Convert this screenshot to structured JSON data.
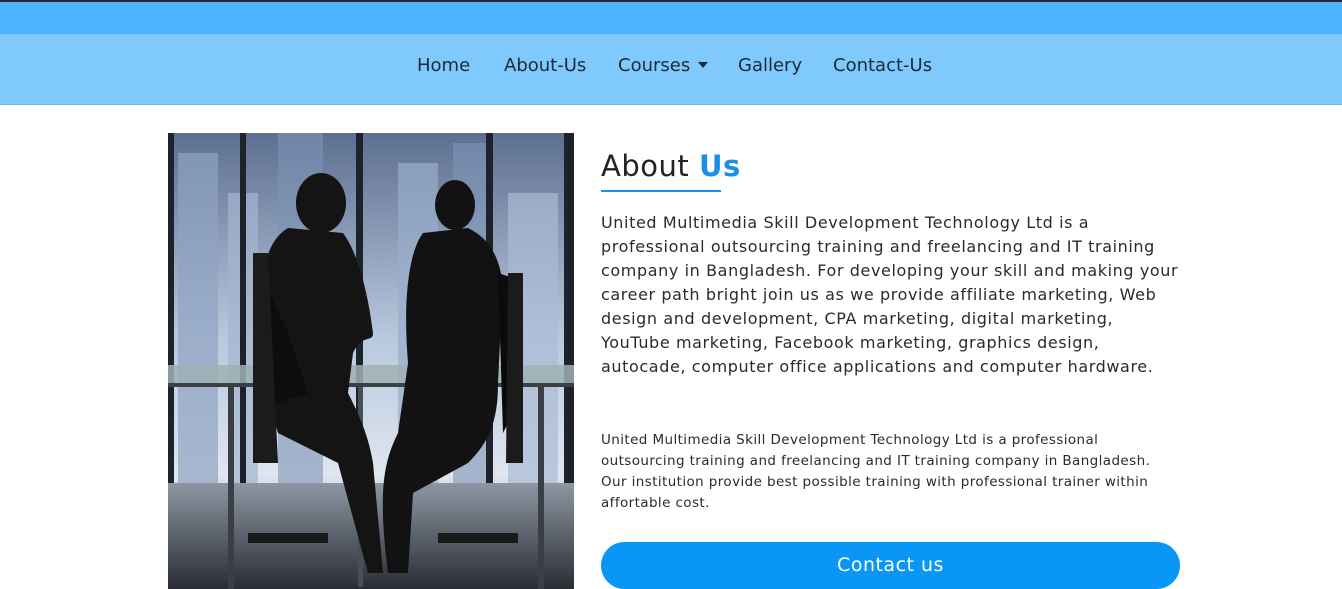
{
  "nav": {
    "items": [
      {
        "label": "Home"
      },
      {
        "label": "About-Us"
      },
      {
        "label": "Courses"
      },
      {
        "label": "Gallery"
      },
      {
        "label": "Contact-Us"
      }
    ]
  },
  "about": {
    "heading_part1": "About",
    "heading_part2": "Us",
    "paragraph1": "United Multimedia Skill Development Technology Ltd is a professional outsourcing training and freelancing and IT training company in Bangladesh. For developing your skill and making your career path bright join us as we provide affiliate marketing, Web design and development, CPA marketing, digital marketing, YouTube marketing, Facebook marketing, graphics design, autocade, computer office applications and computer hardware.",
    "paragraph2": "United Multimedia Skill Development Technology Ltd is a professional outsourcing training and freelancing and IT training company in Bangladesh. Our institution provide best possible training with professional trainer within affortable cost.",
    "button_label": "Contact us"
  },
  "colors": {
    "top_strip": "#4bb3ff",
    "navbar": "#7fc9fc",
    "accent": "#1a8fe8",
    "button": "#0a96f5"
  }
}
